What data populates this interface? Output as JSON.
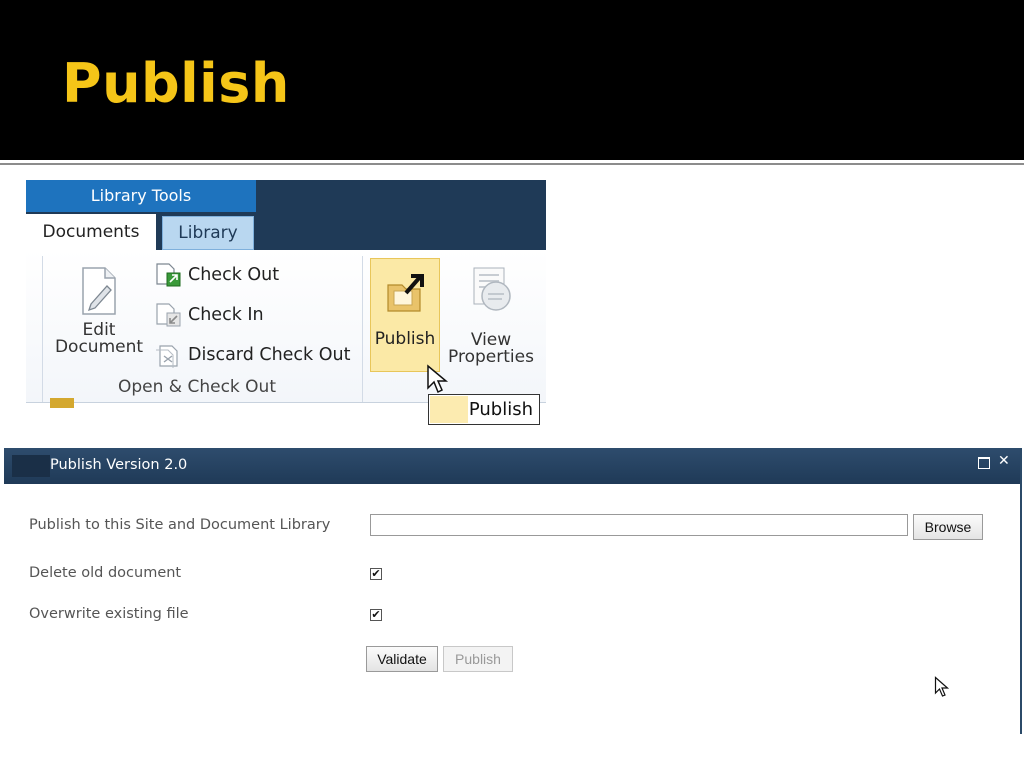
{
  "slide": {
    "title": "Publish"
  },
  "ribbon": {
    "context_tab": "Library Tools",
    "tabs": [
      {
        "label": "Documents"
      },
      {
        "label": "Library"
      }
    ],
    "edit_document": {
      "line1": "Edit",
      "line2": "Document"
    },
    "commands": [
      {
        "label": "Check Out",
        "icon": "check-out-icon"
      },
      {
        "label": "Check In",
        "icon": "check-in-icon"
      },
      {
        "label": "Discard Check Out",
        "icon": "discard-check-out-icon"
      }
    ],
    "group_label": "Open & Check Out",
    "publish_label": "Publish",
    "view_properties": {
      "line1": "View",
      "line2": "Properties"
    },
    "tooltip": "Publish"
  },
  "dialog": {
    "title": "Publish Version 2.0",
    "fields": {
      "site_label": "Publish to this Site and Document Library",
      "site_value": "",
      "browse_label": "Browse",
      "delete_label": "Delete old document",
      "delete_checked": true,
      "overwrite_label": "Overwrite existing file",
      "overwrite_checked": true
    },
    "buttons": {
      "validate": "Validate",
      "publish": "Publish"
    }
  },
  "colors": {
    "title": "#f5c518",
    "ribbon_tab_blue": "#1e73be",
    "ribbon_dark": "#1f3a57",
    "highlight": "#fbe9a6"
  }
}
